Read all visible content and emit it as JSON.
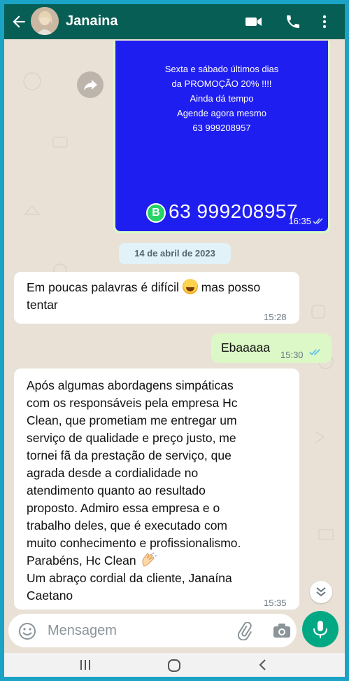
{
  "header": {
    "contact_name": "Janaina",
    "icons": [
      "back-arrow-icon",
      "video-call-icon",
      "voice-call-icon",
      "more-options-icon"
    ]
  },
  "promo": {
    "lines": [
      "Sexta e sábado  últimos dias",
      "da PROMOÇÃO 20% !!!!",
      "Ainda dá tempo",
      "Agende agora mesmo",
      "63 999208957"
    ],
    "phone_big": "63 999208957",
    "wa_badge": "B",
    "time": "16:35"
  },
  "date_chip": "14 de abril de 2023",
  "messages": [
    {
      "direction": "in",
      "text_before_emoji": "Em poucas palavras é difícil",
      "text_after_emoji": " mas posso tentar",
      "time": "15:28"
    },
    {
      "direction": "out",
      "text": "Ebaaaaa",
      "time": "15:30"
    },
    {
      "direction": "in",
      "lines": [
        "Após algumas abordagens simpáticas",
        "com os responsáveis pela empresa Hc",
        "Clean, que prometiam me entregar um",
        "serviço de qualidade e preço justo, me",
        "tornei fã da prestação de serviço, que",
        "agrada desde a cordialidade no",
        "atendimento quanto ao resultado",
        "proposto. Admiro essa empresa e o",
        "trabalho deles, que é executado com",
        "muito conhecimento e  profissionalismo.",
        "Parabéns, Hc Clean",
        "Um abraço cordial da cliente, Janaína",
        "Caetano"
      ],
      "time": "15:35"
    }
  ],
  "input": {
    "placeholder": "Mensagem"
  },
  "colors": {
    "header": "#075e54",
    "outgoing_bubble": "#dcf8c6",
    "incoming_bubble": "#ffffff",
    "promo_bg": "#1f1ef0",
    "mic_button": "#00a884",
    "read_ticks": "#53bdeb"
  }
}
